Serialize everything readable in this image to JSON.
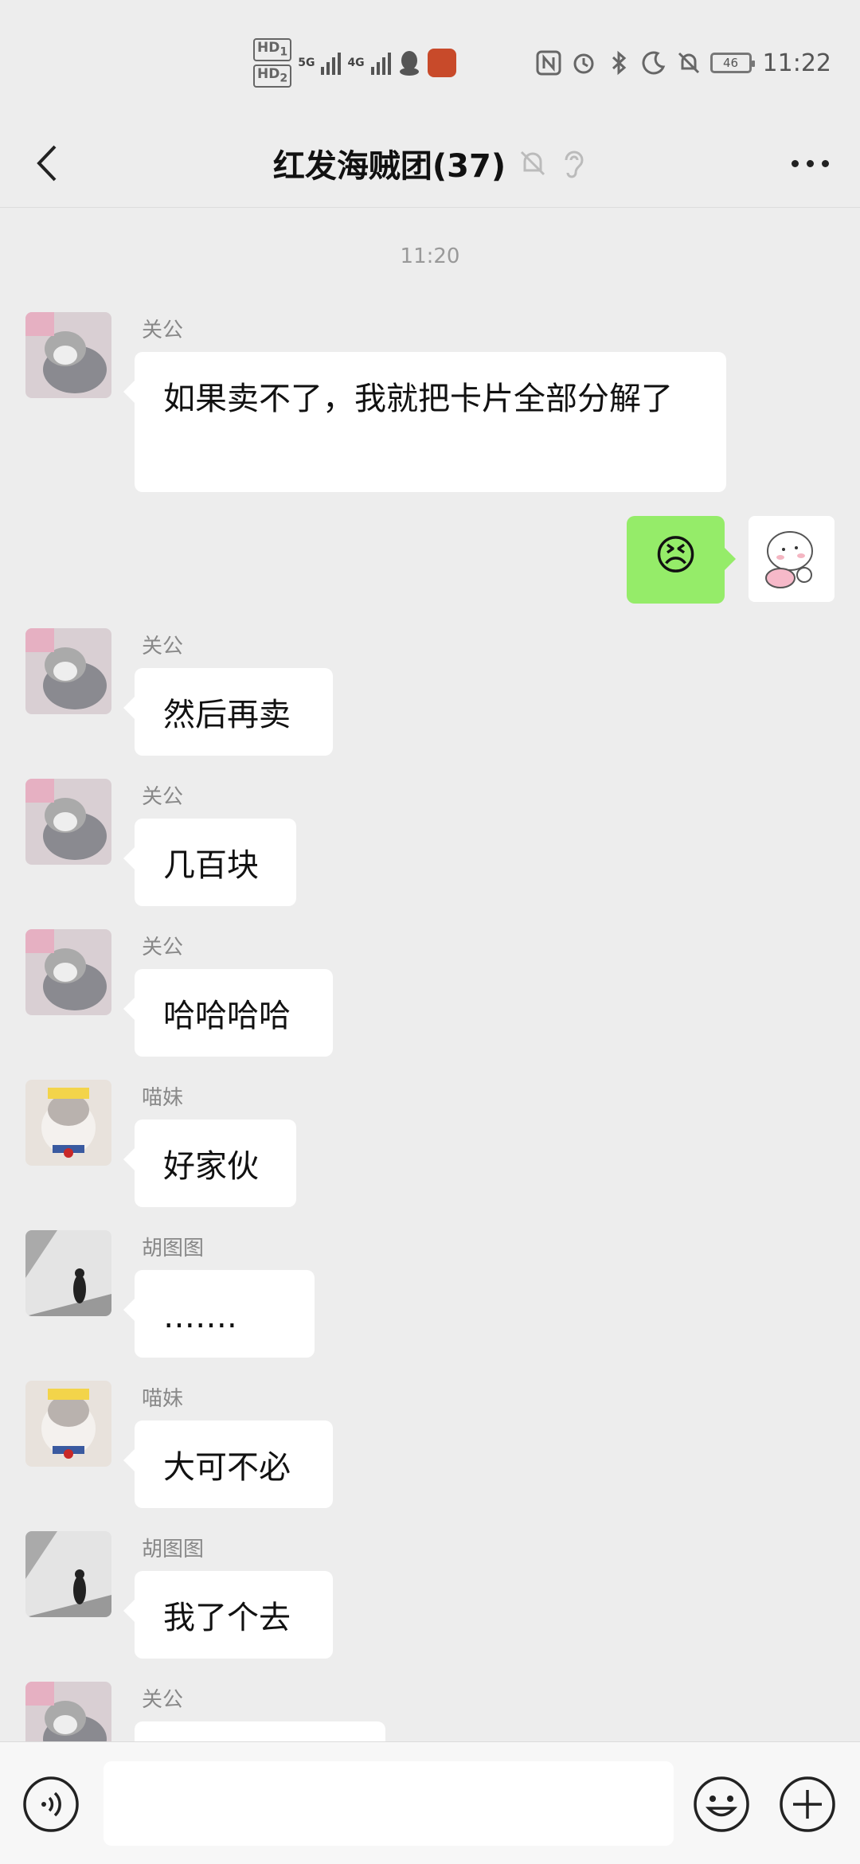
{
  "status_bar": {
    "hd1": "HD",
    "hd1_sub": "1",
    "hd2": "HD",
    "hd2_sub": "2",
    "net1": "5G",
    "net2": "4G",
    "battery": "46",
    "time": "11:22",
    "icons": [
      "qq-icon",
      "game-app-icon",
      "nfc-icon",
      "alarm-icon",
      "bluetooth-icon",
      "moon-icon",
      "mute-bell-icon",
      "battery-icon"
    ]
  },
  "nav": {
    "title": "红发海贼团(37)",
    "icons": [
      "back-icon",
      "mute-bell-icon",
      "ear-icon",
      "more-icon"
    ]
  },
  "chat": {
    "timestamp": "11:20",
    "messages": [
      {
        "sender": "关公",
        "text": "如果卖不了，我就把卡片全部分解了"
      },
      {
        "sender": "",
        "text": "",
        "type": "sent-emoji",
        "emoji": "😣"
      },
      {
        "sender": "关公",
        "text": "然后再卖"
      },
      {
        "sender": "关公",
        "text": "几百块"
      },
      {
        "sender": "关公",
        "text": "哈哈哈哈"
      },
      {
        "sender": "喵妹",
        "text": "好家伙"
      },
      {
        "sender": "胡图图",
        "text": "……."
      },
      {
        "sender": "喵妹",
        "text": "大可不必"
      },
      {
        "sender": "胡图图",
        "text": "我了个去"
      },
      {
        "sender": "关公",
        "text": ""
      }
    ]
  },
  "input_bar": {
    "placeholder": "",
    "icons": [
      "voice-icon",
      "emoji-icon",
      "plus-icon"
    ]
  },
  "colors": {
    "background": "#ededed",
    "sent_bubble": "#95ec69",
    "received_bubble": "#ffffff"
  }
}
